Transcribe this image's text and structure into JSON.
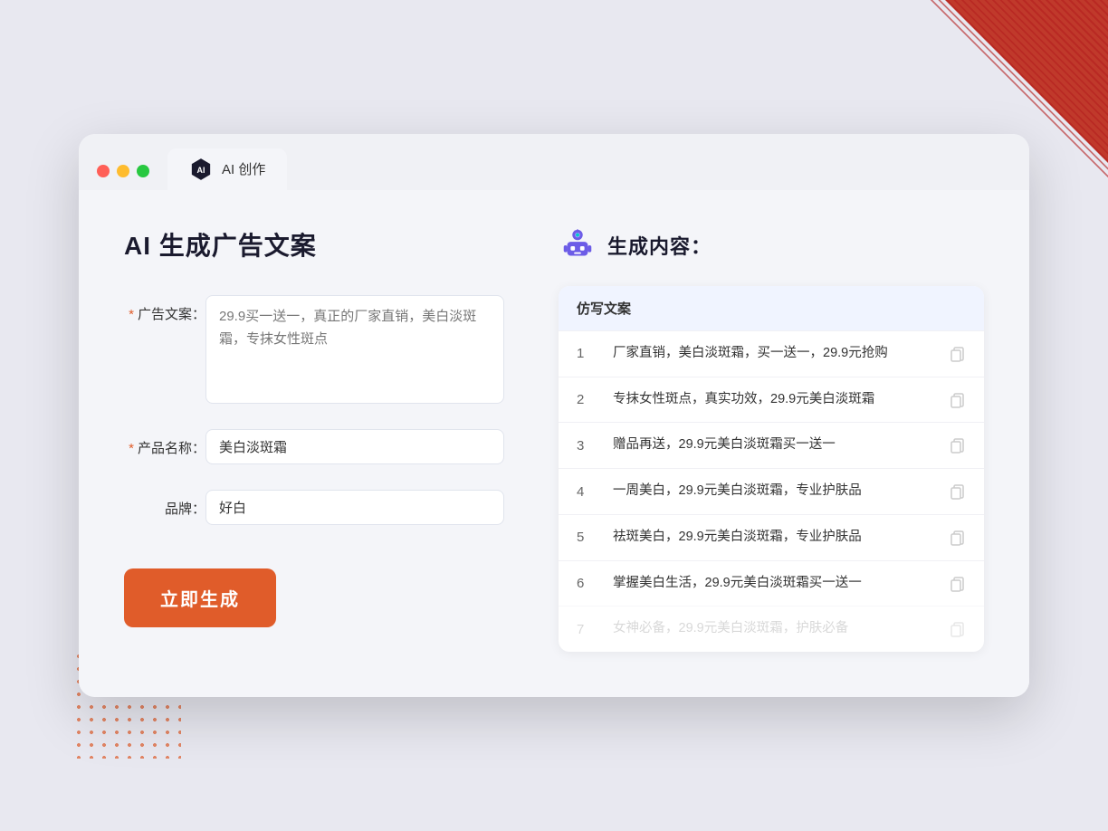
{
  "window": {
    "tab_label": "AI 创作"
  },
  "page": {
    "title": "AI 生成广告文案",
    "right_title": "生成内容："
  },
  "form": {
    "ad_copy_label": "广告文案：",
    "ad_copy_required": "*",
    "ad_copy_placeholder": "29.9买一送一，真正的厂家直销，美白淡斑霜，专抹女性斑点",
    "product_name_label": "产品名称：",
    "product_name_required": "*",
    "product_name_value": "美白淡斑霜",
    "brand_label": "品牌：",
    "brand_value": "好白",
    "generate_button": "立即生成"
  },
  "results": {
    "column_header": "仿写文案",
    "items": [
      {
        "num": "1",
        "text": "厂家直销，美白淡斑霜，买一送一，29.9元抢购"
      },
      {
        "num": "2",
        "text": "专抹女性斑点，真实功效，29.9元美白淡斑霜"
      },
      {
        "num": "3",
        "text": "赠品再送，29.9元美白淡斑霜买一送一"
      },
      {
        "num": "4",
        "text": "一周美白，29.9元美白淡斑霜，专业护肤品"
      },
      {
        "num": "5",
        "text": "祛斑美白，29.9元美白淡斑霜，专业护肤品"
      },
      {
        "num": "6",
        "text": "掌握美白生活，29.9元美白淡斑霜买一送一"
      },
      {
        "num": "7",
        "text": "女神必备，29.9元美白淡斑霜，护肤必备",
        "faded": true
      }
    ]
  }
}
